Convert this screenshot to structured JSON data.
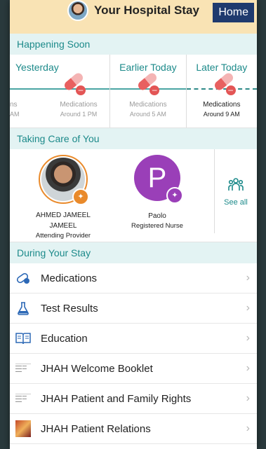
{
  "header": {
    "title": "Your Hospital Stay",
    "home_label": "Home"
  },
  "happening_soon": {
    "section_title": "Happening Soon",
    "columns": [
      {
        "heading": "Yesterday",
        "items": [
          {
            "label": "ns",
            "time": "AM"
          },
          {
            "label": "Medications",
            "time": "Around 1 PM"
          }
        ]
      },
      {
        "heading": "Earlier Today",
        "items": [
          {
            "label": "Medications",
            "time": "Around 5 AM"
          }
        ]
      },
      {
        "heading": "Later Today",
        "items": [
          {
            "label": "Medications",
            "time": "Around 9 AM"
          }
        ]
      }
    ]
  },
  "care": {
    "section_title": "Taking Care of You",
    "providers": [
      {
        "name_line1": "AHMED JAMEEL",
        "name_line2": "JAMEEL",
        "role": "Attending Provider",
        "pin_color": "#e98a2b"
      },
      {
        "initial": "P",
        "name_line1": "Paolo",
        "role": "Registered Nurse",
        "avatar_color": "#9a3fb8",
        "pin_color": "#9a3fb8"
      }
    ],
    "see_all": "See all"
  },
  "stay": {
    "section_title": "During Your Stay",
    "items": [
      {
        "label": "Medications",
        "icon": "pill-icon"
      },
      {
        "label": "Test Results",
        "icon": "flask-icon"
      },
      {
        "label": "Education",
        "icon": "book-icon"
      },
      {
        "label": "JHAH Welcome Booklet",
        "icon": "document-thumbnail-icon"
      },
      {
        "label": "JHAH Patient and Family Rights",
        "icon": "document-thumbnail-icon"
      },
      {
        "label": "JHAH Patient Relations",
        "icon": "image-thumbnail-icon"
      }
    ]
  },
  "colors": {
    "accent": "#1c8a8a",
    "header_bg": "#f9e3b4",
    "home_bg": "#1f3a6e",
    "pill_red": "#e35555"
  }
}
